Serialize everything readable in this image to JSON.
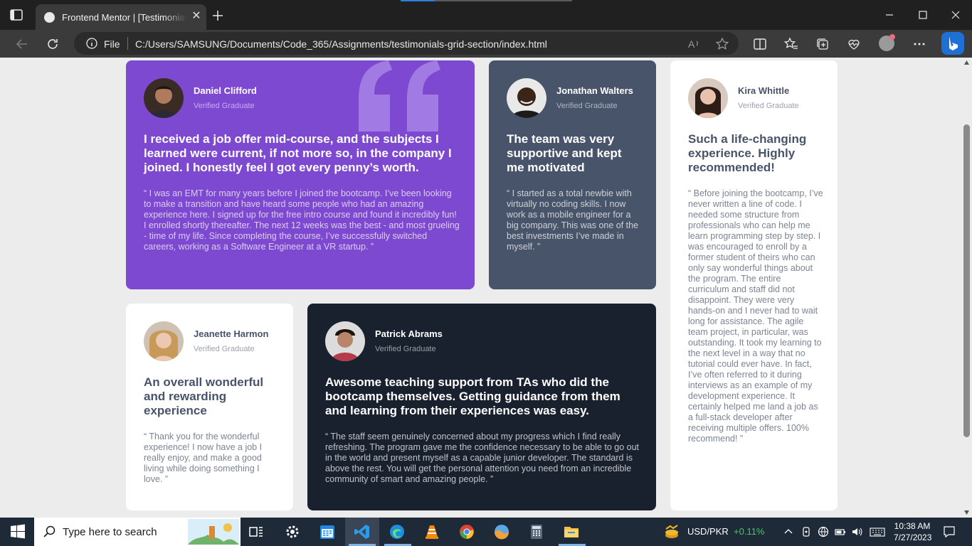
{
  "browser": {
    "tab_title": "Frontend Mentor | [Testimonials grid section]",
    "url_scheme": "File",
    "url": "C:/Users/SAMSUNG/Documents/Code_365/Assignments/testimonials-grid-section/index.html",
    "page_load_progress": 0.2
  },
  "testimonials": [
    {
      "name": "Daniel Clifford",
      "role": "Verified Graduate",
      "title": "I received a job offer mid-course, and the subjects I learned were current, if not more so, in the company I joined. I honestly feel I got every penny’s worth.",
      "quote": "“ I was an EMT for many years before I joined the bootcamp. I’ve been looking to make a transition and have heard some people who had an amazing experience here. I signed up for the free intro course and found it incredibly fun! I enrolled shortly thereafter. The next 12 weeks was the best - and most grueling - time of my life. Since completing the course, I’ve successfully switched careers, working as a Software Engineer at a VR startup. ”"
    },
    {
      "name": "Jonathan Walters",
      "role": "Verified Graduate",
      "title": "The team was very supportive and kept me motivated",
      "quote": "“ I started as a total newbie with virtually no coding skills. I now work as a mobile engineer for a big company. This was one of the best investments I’ve made in myself. ”"
    },
    {
      "name": "Kira Whittle",
      "role": "Verified Graduate",
      "title": "Such a life-changing experience. Highly recommended!",
      "quote": "“ Before joining the bootcamp, I’ve never written a line of code. I needed some structure from professionals who can help me learn programming step by step. I was encouraged to enroll by a former student of theirs who can only say wonderful things about the program. The entire curriculum and staff did not disappoint. They were very hands-on and I never had to wait long for assistance. The agile team project, in particular, was outstanding. It took my learning to the next level in a way that no tutorial could ever have. In fact, I’ve often referred to it during interviews as an example of my development experience. It certainly helped me land a job as a full-stack developer after receiving multiple offers. 100% recommend! ”"
    },
    {
      "name": "Jeanette Harmon",
      "role": "Verified Graduate",
      "title": "An overall wonderful and rewarding experience",
      "quote": "“ Thank you for the wonderful experience! I now have a job I really enjoy, and make a good living while doing something I love. ”"
    },
    {
      "name": "Patrick Abrams",
      "role": "Verified Graduate",
      "title": "Awesome teaching support from TAs who did the bootcamp themselves. Getting guidance from them and learning from their experiences was easy.",
      "quote": "“ The staff seem genuinely concerned about my progress which I find really refreshing. The program gave me the confidence necessary to be able to go out in the world and present myself as a capable junior developer. The standard is above the rest. You will get the personal attention you need from an incredible community of smart and amazing people. ”"
    }
  ],
  "taskbar": {
    "search_placeholder": "Type here to search",
    "stock_label": "USD/PKR",
    "stock_change": "+0.11%",
    "time": "10:38 AM",
    "date": "7/27/2023"
  },
  "colors": {
    "violet": "#7d49d0",
    "grayish_blue": "#48546a",
    "dark_blackish_blue": "#19212e",
    "background": "#ececec"
  },
  "icons": [
    "window-sidebar-icon",
    "favicon-icon",
    "close-icon",
    "plus-icon",
    "minimize-icon",
    "maximize-icon",
    "back-icon",
    "refresh-icon",
    "info-icon",
    "read-aloud-icon",
    "favorite-star-icon",
    "split-screen-icon",
    "favorites-icon",
    "collections-icon",
    "performance-icon",
    "profile-icon",
    "more-icon",
    "bing-icon",
    "windows-start-icon",
    "search-icon",
    "task-view-icon",
    "settings-icon",
    "calendar-icon",
    "vscode-icon",
    "edge-icon",
    "vlc-icon",
    "chrome-icon",
    "photos-icon",
    "calculator-icon",
    "file-explorer-icon",
    "stock-icon",
    "chevron-up-icon",
    "network-icon",
    "battery-icon",
    "volume-icon",
    "keyboard-icon",
    "notification-icon"
  ]
}
